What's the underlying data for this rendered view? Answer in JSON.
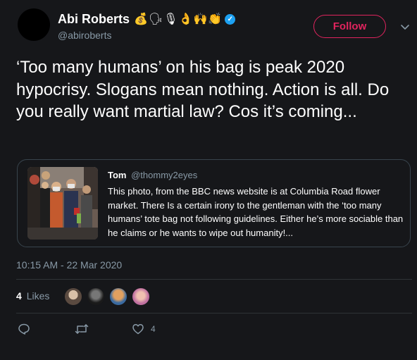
{
  "author": {
    "display_name": "Abi Roberts",
    "emojis": "💰🗣🎙👌🙌👏",
    "verified_glyph": "✓",
    "handle": "@abiroberts",
    "follow_label": "Follow"
  },
  "tweet": {
    "text": "‘Too many humans’ on his bag is peak 2020 hypocrisy. Slogans mean nothing. Action is all. Do you really want martial law? Cos it’s coming...",
    "timestamp": "10:15 AM - 22 Mar 2020"
  },
  "quoted_tweet": {
    "name": "Tom",
    "handle": "@thommy2eyes",
    "text": "This photo, from the BBC news website is at Columbia Road flower market. There Is a certain irony to the gentleman with the ‘too many humans’ tote bag not following guidelines. Either he’s more sociable than he claims or he wants to wipe out humanity!..."
  },
  "likes": {
    "count": "4",
    "label": "Likes"
  },
  "actions": {
    "like_count": "4"
  },
  "colors": {
    "background": "#16171a",
    "accent_follow": "#e0245e",
    "secondary_text": "#8899a6",
    "verified": "#1da1f2"
  },
  "icons": [
    "chevron-down-icon",
    "reply-icon",
    "retweet-icon",
    "heart-icon",
    "verified-badge-icon"
  ]
}
